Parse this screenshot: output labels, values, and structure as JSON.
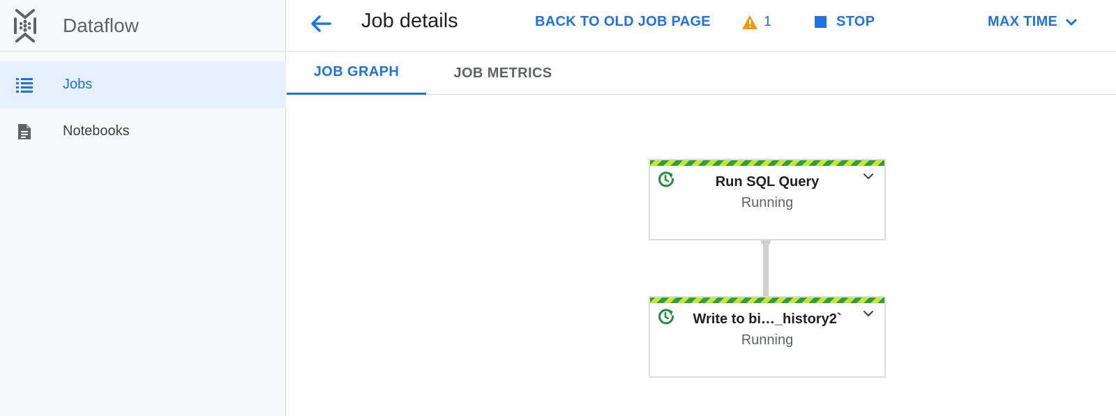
{
  "app": {
    "product_name": "Dataflow"
  },
  "sidebar": {
    "items": [
      {
        "label": "Jobs",
        "icon": "list-icon",
        "active": true
      },
      {
        "label": "Notebooks",
        "icon": "document-icon",
        "active": false
      }
    ]
  },
  "header": {
    "title": "Job details",
    "back_to_old_label": "BACK TO OLD JOB PAGE",
    "warning_count": "1",
    "stop_label": "STOP",
    "max_time_label": "MAX TIME"
  },
  "tabs": [
    {
      "label": "JOB GRAPH",
      "active": true
    },
    {
      "label": "JOB METRICS",
      "active": false
    }
  ],
  "graph": {
    "nodes": [
      {
        "title": "Run SQL Query",
        "status": "Running"
      },
      {
        "title": "Write to bi…_history2`",
        "status": "Running"
      }
    ]
  },
  "colors": {
    "accent": "#1a73e8",
    "warning": "#f29900",
    "running_green": "#1e8e3e",
    "stripe_green": "#2e9e44",
    "stripe_lime": "#c6e82a"
  }
}
